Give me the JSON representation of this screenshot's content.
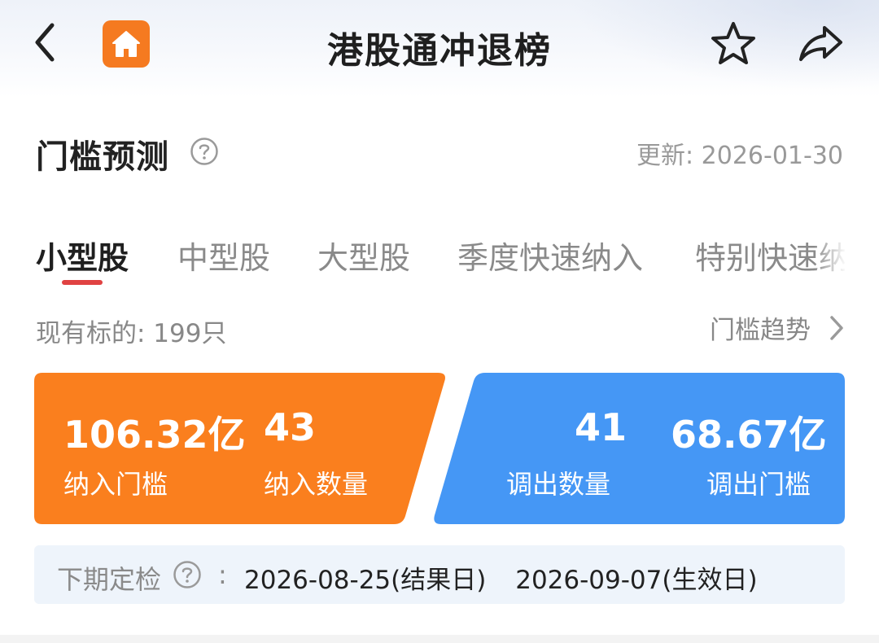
{
  "header": {
    "title": "港股通冲退榜",
    "back_icon": "back-arrow-icon",
    "home_icon": "home-icon",
    "favorite_icon": "star-icon",
    "share_icon": "share-icon"
  },
  "section": {
    "title": "门槛预测",
    "help_icon": "question-circle-icon",
    "update_text": "更新: 2026-01-30"
  },
  "tabs": [
    {
      "label": "小型股",
      "active": true
    },
    {
      "label": "中型股",
      "active": false
    },
    {
      "label": "大型股",
      "active": false
    },
    {
      "label": "季度快速纳入",
      "active": false
    },
    {
      "label": "特别快速纳",
      "active": false
    }
  ],
  "summary": {
    "count_text": "现有标的: 199只",
    "trend_link": "门槛趋势"
  },
  "inclusion": {
    "threshold_value": "106.32亿",
    "threshold_label": "纳入门槛",
    "count_value": "43",
    "count_label": "纳入数量",
    "color": "#fa7f1e"
  },
  "exclusion": {
    "count_value": "41",
    "count_label": "调出数量",
    "threshold_value": "68.67亿",
    "threshold_label": "调出门槛",
    "color": "#4597f5"
  },
  "schedule": {
    "label": "下期定检",
    "colon": ":",
    "result_date": "2026-08-25(结果日)",
    "effective_date": "2026-09-07(生效日)"
  }
}
